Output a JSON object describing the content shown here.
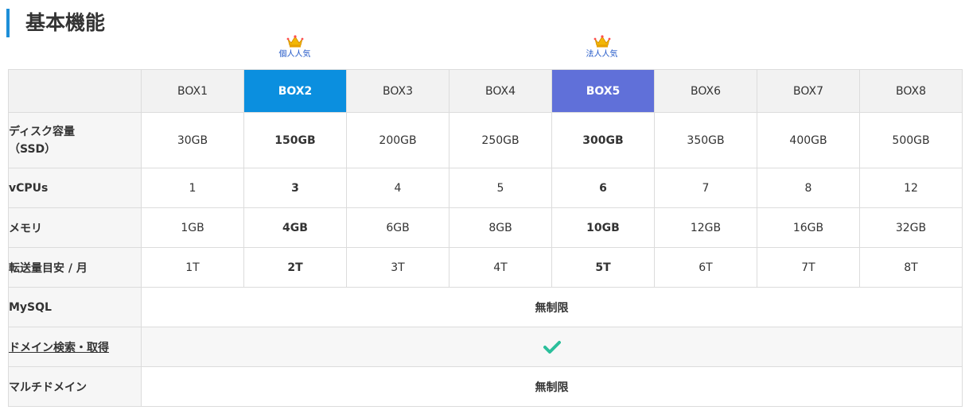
{
  "section": {
    "title": "基本機能"
  },
  "badges": {
    "personal": {
      "label": "個人人気",
      "icon": "crown-icon"
    },
    "corporate": {
      "label": "法人人気",
      "icon": "crown-icon"
    }
  },
  "colors": {
    "accent": "#1d8ed8",
    "box2": "#0b8fdf",
    "box5": "#6070d9",
    "check": "#2bbf9b"
  },
  "columns": [
    "BOX1",
    "BOX2",
    "BOX3",
    "BOX4",
    "BOX5",
    "BOX6",
    "BOX7",
    "BOX8"
  ],
  "rows": {
    "disk": {
      "label_line1": "ディスク容量",
      "label_line2": "（SSD）",
      "values": [
        "30GB",
        "150GB",
        "200GB",
        "250GB",
        "300GB",
        "350GB",
        "400GB",
        "500GB"
      ]
    },
    "vcpu": {
      "label": "vCPUs",
      "values": [
        "1",
        "3",
        "4",
        "5",
        "6",
        "7",
        "8",
        "12"
      ]
    },
    "memory": {
      "label": "メモリ",
      "values": [
        "1GB",
        "4GB",
        "6GB",
        "8GB",
        "10GB",
        "12GB",
        "16GB",
        "32GB"
      ]
    },
    "transfer": {
      "label": "転送量目安 / 月",
      "values": [
        "1T",
        "2T",
        "3T",
        "4T",
        "5T",
        "6T",
        "7T",
        "8T"
      ]
    },
    "mysql": {
      "label": "MySQL",
      "value": "無制限"
    },
    "domain_search": {
      "label": "ドメイン検索・取得",
      "value_icon": "check-icon"
    },
    "multi_domain": {
      "label": "マルチドメイン",
      "value": "無制限"
    }
  }
}
